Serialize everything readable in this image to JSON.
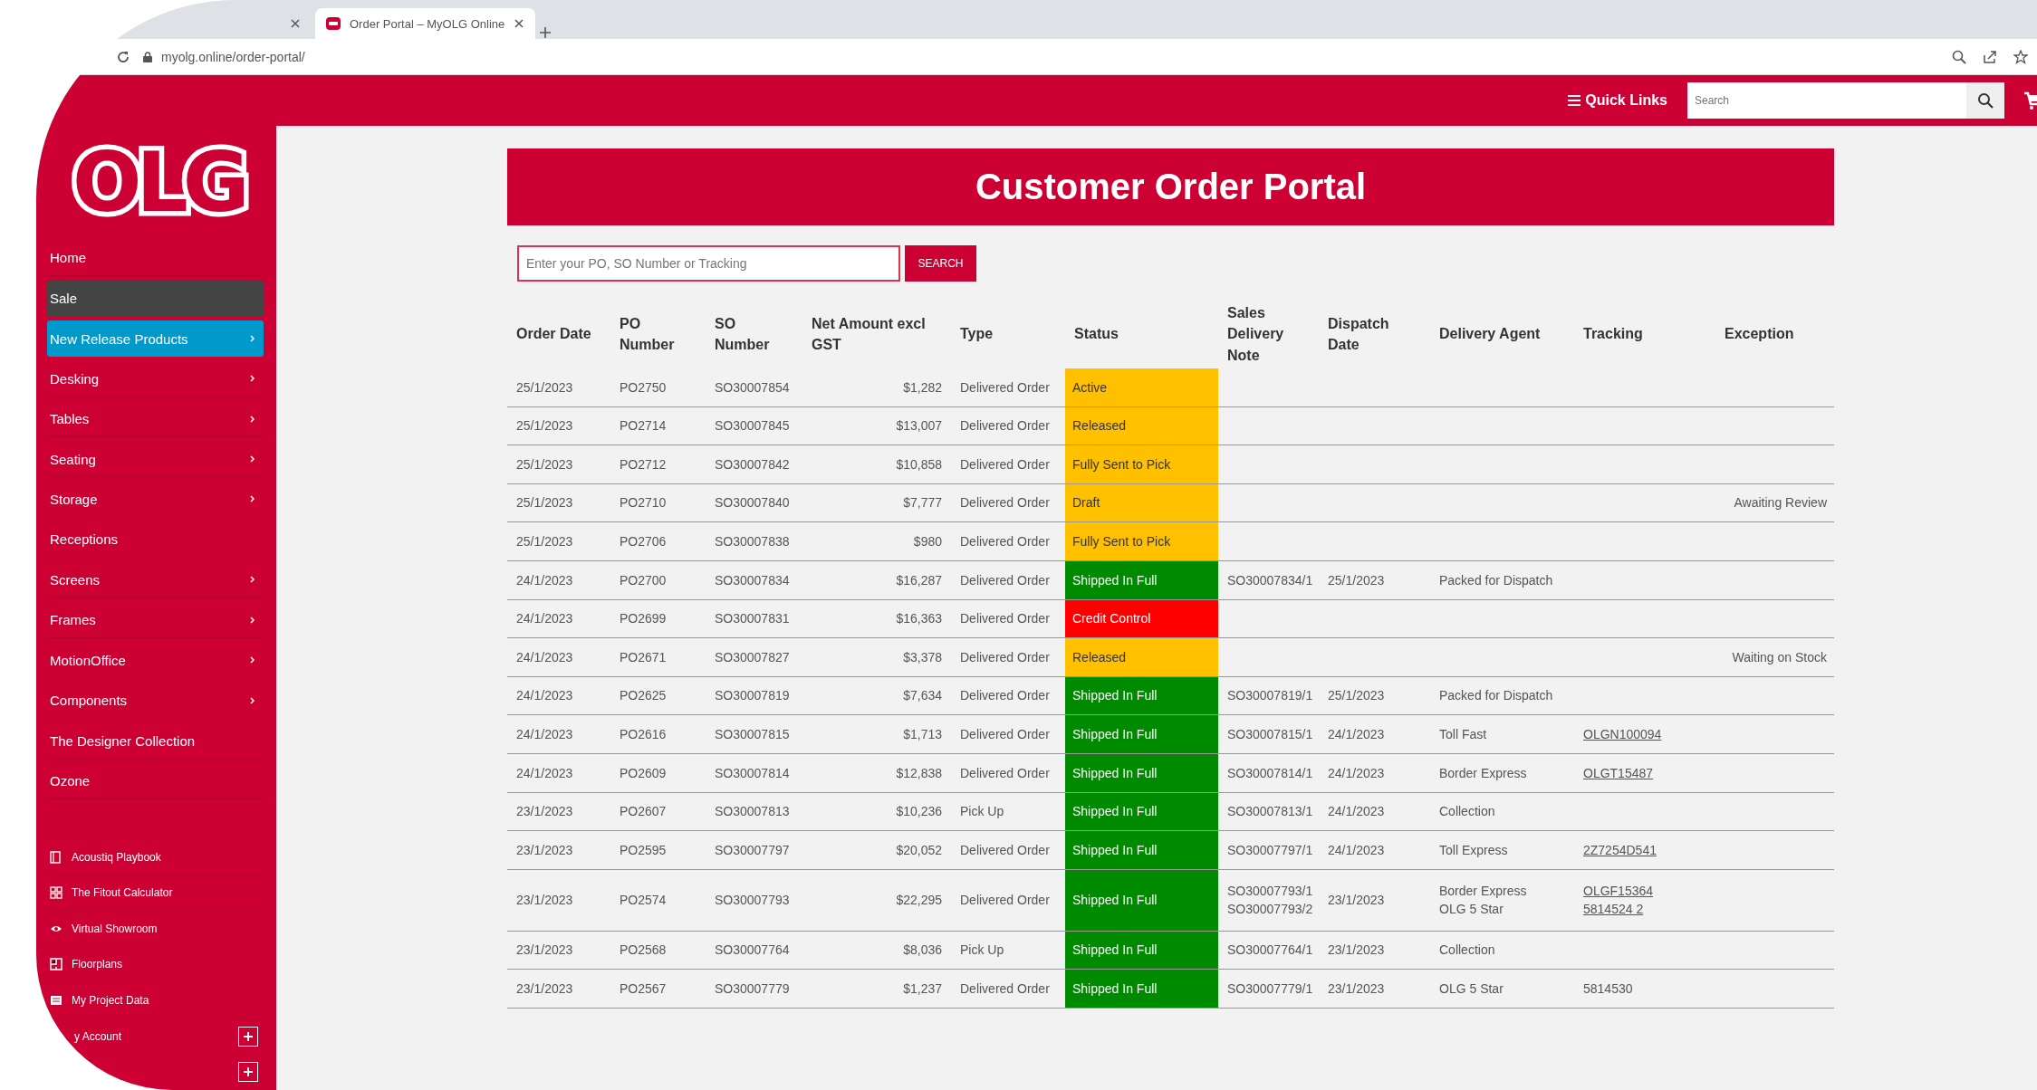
{
  "browser": {
    "tabs": [
      {
        "selected": false
      },
      {
        "label": "Order Portal – MyOLG Online",
        "selected": true
      }
    ],
    "url": "myolg.online/order-portal/"
  },
  "header": {
    "quick_links": "Quick Links",
    "search_placeholder": "Search"
  },
  "sidebar": {
    "logo": "OLG",
    "items": [
      {
        "label": "Home",
        "kind": "plain",
        "submenu": false
      },
      {
        "label": "Sale",
        "kind": "sale",
        "submenu": false
      },
      {
        "label": "New Release Products",
        "kind": "featured",
        "submenu": true
      },
      {
        "label": "Desking",
        "kind": "plain",
        "submenu": true
      },
      {
        "label": "Tables",
        "kind": "plain",
        "submenu": true
      },
      {
        "label": "Seating",
        "kind": "plain",
        "submenu": true
      },
      {
        "label": "Storage",
        "kind": "plain",
        "submenu": true
      },
      {
        "label": "Receptions",
        "kind": "plain",
        "submenu": false
      },
      {
        "label": "Screens",
        "kind": "plain",
        "submenu": true
      },
      {
        "label": "Frames",
        "kind": "plain",
        "submenu": true
      },
      {
        "label": "MotionOffice",
        "kind": "plain",
        "submenu": true
      },
      {
        "label": "Components",
        "kind": "plain",
        "submenu": true
      },
      {
        "label": "The Designer Collection",
        "kind": "plain",
        "submenu": false
      },
      {
        "label": "Ozone",
        "kind": "plain",
        "submenu": false
      }
    ],
    "links": [
      {
        "label": "Acoustiq Playbook",
        "kind": "book"
      },
      {
        "label": "The Fitout Calculator",
        "kind": "grid"
      },
      {
        "label": "Virtual Showroom",
        "kind": "eye"
      },
      {
        "label": "Floorplans",
        "kind": "plan"
      },
      {
        "label": "My Project Data",
        "kind": "data"
      }
    ],
    "expandables": [
      {
        "label": "y Account",
        "expanded": false
      },
      {
        "expanded": false
      }
    ]
  },
  "portal": {
    "title": "Customer Order Portal",
    "search": {
      "placeholder": "Enter your PO, SO Number or Tracking",
      "button": "SEARCH"
    },
    "table": {
      "columns": [
        "Order Date",
        "PO Number",
        "SO Number",
        "Net Amount excl GST",
        "Type",
        "Status",
        "Sales Delivery Note",
        "Dispatch Date",
        "Delivery Agent",
        "Tracking",
        "Exception"
      ],
      "rows": [
        {
          "order_date": "25/1/2023",
          "po_number": "PO2750",
          "so_number": "SO30007854",
          "net_amount": "$1,282",
          "type": "Delivered Order",
          "status": {
            "text": "Active",
            "color": "#ffc000"
          }
        },
        {
          "order_date": "25/1/2023",
          "po_number": "PO2714",
          "so_number": "SO30007845",
          "net_amount": "$13,007",
          "type": "Delivered Order",
          "status": {
            "text": "Released",
            "color": "#ffc000"
          }
        },
        {
          "order_date": "25/1/2023",
          "po_number": "PO2712",
          "so_number": "SO30007842",
          "net_amount": "$10,858",
          "type": "Delivered Order",
          "status": {
            "text": "Fully Sent to Pick",
            "color": "#ffc000"
          }
        },
        {
          "order_date": "25/1/2023",
          "po_number": "PO2710",
          "so_number": "SO30007840",
          "net_amount": "$7,777",
          "type": "Delivered Order",
          "status": {
            "text": "Draft",
            "color": "#ffc000"
          },
          "exception": "Awaiting Review"
        },
        {
          "order_date": "25/1/2023",
          "po_number": "PO2706",
          "so_number": "SO30007838",
          "net_amount": "$980",
          "type": "Delivered Order",
          "status": {
            "text": "Fully Sent to Pick",
            "color": "#ffc000"
          }
        },
        {
          "order_date": "24/1/2023",
          "po_number": "PO2700",
          "so_number": "SO30007834",
          "net_amount": "$16,287",
          "type": "Delivered Order",
          "status": {
            "text": "Shipped In Full",
            "color": "#008a00"
          },
          "sales_delivery_note": [
            "SO30007834/1"
          ],
          "dispatch_date": "25/1/2023",
          "delivery_agent": [
            "Packed for Dispatch"
          ]
        },
        {
          "order_date": "24/1/2023",
          "po_number": "PO2699",
          "so_number": "SO30007831",
          "net_amount": "$16,363",
          "type": "Delivered Order",
          "status": {
            "text": "Credit Control",
            "color": "#ff0000"
          }
        },
        {
          "order_date": "24/1/2023",
          "po_number": "PO2671",
          "so_number": "SO30007827",
          "net_amount": "$3,378",
          "type": "Delivered Order",
          "status": {
            "text": "Released",
            "color": "#ffc000"
          },
          "exception": "Waiting on Stock"
        },
        {
          "order_date": "24/1/2023",
          "po_number": "PO2625",
          "so_number": "SO30007819",
          "net_amount": "$7,634",
          "type": "Delivered Order",
          "status": {
            "text": "Shipped In Full",
            "color": "#008a00"
          },
          "sales_delivery_note": [
            "SO30007819/1"
          ],
          "dispatch_date": "25/1/2023",
          "delivery_agent": [
            "Packed for Dispatch"
          ]
        },
        {
          "order_date": "24/1/2023",
          "po_number": "PO2616",
          "so_number": "SO30007815",
          "net_amount": "$1,713",
          "type": "Delivered Order",
          "status": {
            "text": "Shipped In Full",
            "color": "#008a00"
          },
          "sales_delivery_note": [
            "SO30007815/1"
          ],
          "dispatch_date": "24/1/2023",
          "delivery_agent": [
            "Toll Fast"
          ],
          "tracking": [
            {
              "text": "OLGN100094",
              "link": true
            }
          ]
        },
        {
          "order_date": "24/1/2023",
          "po_number": "PO2609",
          "so_number": "SO30007814",
          "net_amount": "$12,838",
          "type": "Delivered Order",
          "status": {
            "text": "Shipped In Full",
            "color": "#008a00"
          },
          "sales_delivery_note": [
            "SO30007814/1"
          ],
          "dispatch_date": "24/1/2023",
          "delivery_agent": [
            "Border Express"
          ],
          "tracking": [
            {
              "text": "OLGT15487",
              "link": true
            }
          ]
        },
        {
          "order_date": "23/1/2023",
          "po_number": "PO2607",
          "so_number": "SO30007813",
          "net_amount": "$10,236",
          "type": "Pick Up",
          "status": {
            "text": "Shipped In Full",
            "color": "#008a00"
          },
          "sales_delivery_note": [
            "SO30007813/1"
          ],
          "dispatch_date": "24/1/2023",
          "delivery_agent": [
            "Collection"
          ]
        },
        {
          "order_date": "23/1/2023",
          "po_number": "PO2595",
          "so_number": "SO30007797",
          "net_amount": "$20,052",
          "type": "Delivered Order",
          "status": {
            "text": "Shipped In Full",
            "color": "#008a00"
          },
          "sales_delivery_note": [
            "SO30007797/1"
          ],
          "dispatch_date": "24/1/2023",
          "delivery_agent": [
            "Toll Express"
          ],
          "tracking": [
            {
              "text": "2Z7254D541",
              "link": true
            }
          ]
        },
        {
          "order_date": "23/1/2023",
          "po_number": "PO2574",
          "so_number": "SO30007793",
          "net_amount": "$22,295",
          "type": "Delivered Order",
          "status": {
            "text": "Shipped In Full",
            "color": "#008a00"
          },
          "sales_delivery_note": [
            "SO30007793/1",
            "SO30007793/2"
          ],
          "dispatch_date": "23/1/2023",
          "delivery_agent": [
            "Border Express",
            "OLG 5 Star"
          ],
          "tracking": [
            {
              "text": "OLGF15364",
              "link": true
            },
            {
              "text": "5814524 2",
              "link": true
            }
          ]
        },
        {
          "order_date": "23/1/2023",
          "po_number": "PO2568",
          "so_number": "SO30007764",
          "net_amount": "$8,036",
          "type": "Pick Up",
          "status": {
            "text": "Shipped In Full",
            "color": "#008a00"
          },
          "sales_delivery_note": [
            "SO30007764/1"
          ],
          "dispatch_date": "23/1/2023",
          "delivery_agent": [
            "Collection"
          ]
        },
        {
          "order_date": "23/1/2023",
          "po_number": "PO2567",
          "so_number": "SO30007779",
          "net_amount": "$1,237",
          "type": "Delivered Order",
          "status": {
            "text": "Shipped In Full",
            "color": "#008a00"
          },
          "sales_delivery_note": [
            "SO30007779/1"
          ],
          "dispatch_date": "23/1/2023",
          "delivery_agent": [
            "OLG 5 Star"
          ],
          "tracking": [
            {
              "text": "5814530",
              "link": false
            }
          ]
        }
      ]
    }
  }
}
